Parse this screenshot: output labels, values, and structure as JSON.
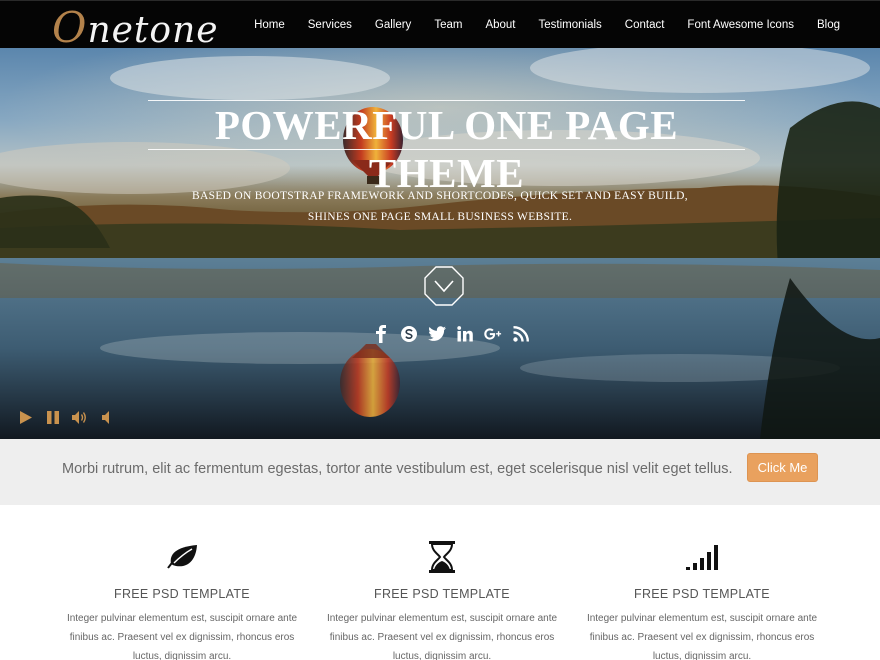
{
  "header": {
    "logo_first": "O",
    "logo_rest": "netone",
    "nav": [
      "Home",
      "Services",
      "Gallery",
      "Team",
      "About",
      "Testimonials",
      "Contact",
      "Font Awesome Icons",
      "Blog"
    ]
  },
  "hero": {
    "title": "POWERFUL ONE PAGE THEME",
    "subtitle_line1": "BASED ON BOOTSTRAP FRAMEWORK AND SHORTCODES, QUICK SET AND EASY BUILD,",
    "subtitle_line2": "SHINES ONE PAGE SMALL BUSINESS WEBSITE.",
    "social_icons": [
      "facebook-icon",
      "skype-icon",
      "twitter-icon",
      "linkedin-icon",
      "google-plus-icon",
      "rss-icon"
    ],
    "player_icons": [
      "play-icon",
      "pause-icon",
      "volume-up-icon",
      "volume-down-icon"
    ]
  },
  "cta": {
    "text": "Morbi rutrum, elit ac fermentum egestas, tortor ante vestibulum est, eget scelerisque nisl velit eget tellus.",
    "button": "Click Me"
  },
  "features": [
    {
      "icon": "leaf-icon",
      "title": "FREE PSD TEMPLATE",
      "text": "Integer pulvinar elementum est, suscipit ornare ante finibus ac. Praesent vel ex dignissim, rhoncus eros luctus, dignissim arcu."
    },
    {
      "icon": "hourglass-icon",
      "title": "FREE PSD TEMPLATE",
      "text": "Integer pulvinar elementum est, suscipit ornare ante finibus ac. Praesent vel ex dignissim, rhoncus eros luctus, dignissim arcu."
    },
    {
      "icon": "signal-icon",
      "title": "FREE PSD TEMPLATE",
      "text": "Integer pulvinar elementum est, suscipit ornare ante finibus ac. Praesent vel ex dignissim, rhoncus eros luctus, dignissim arcu."
    }
  ],
  "colors": {
    "header_bg": "#050505",
    "accent": "#e9a15e",
    "logo_accent": "#b3824b",
    "cta_bg": "#eeeeee"
  }
}
